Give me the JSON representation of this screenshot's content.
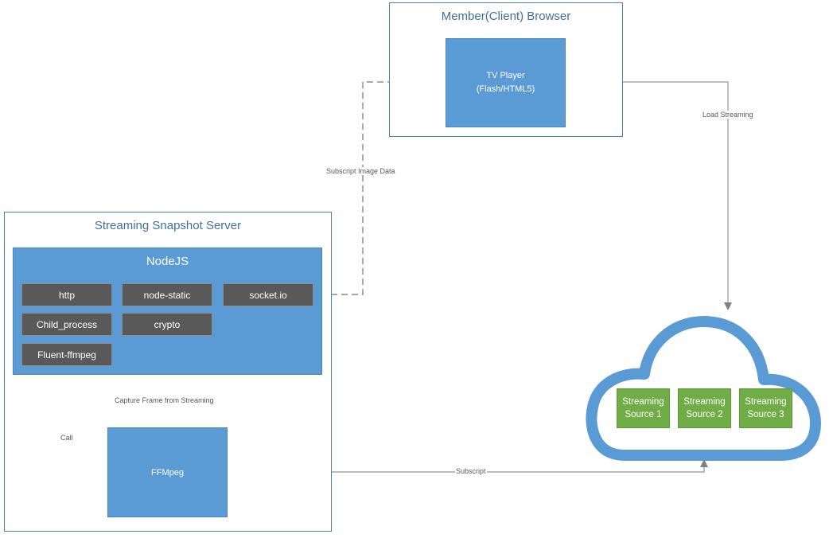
{
  "client_browser": {
    "title": "Member(Client) Browser",
    "tv_player": {
      "line1": "TV Player",
      "line2": "(Flash/HTML5)"
    }
  },
  "server": {
    "title": "Streaming Snapshot Server",
    "nodejs": {
      "title": "NodeJS",
      "modules": [
        "http",
        "node-static",
        "socket.io",
        "Child_process",
        "crypto",
        "Fluent-ffmpeg"
      ]
    },
    "ffmpeg": {
      "label": "FFMpeg"
    }
  },
  "cloud": {
    "sources": [
      {
        "line1": "Streaming",
        "line2": "Source 1"
      },
      {
        "line1": "Streaming",
        "line2": "Source 2"
      },
      {
        "line1": "Streaming",
        "line2": "Source 3"
      }
    ]
  },
  "edges": {
    "subscript_image_data": "Subscript Image Data",
    "load_streaming": "Load Streaming",
    "capture_frame": "Capture Frame from Streaming",
    "call": "Call",
    "subscript": "Subscript"
  },
  "colors": {
    "container_border": "#4a7fb5",
    "title_text": "#41719c",
    "node_blue": "#5b9bd5",
    "module_gray": "#595959",
    "source_green": "#70ad47",
    "connector": "#808080"
  }
}
